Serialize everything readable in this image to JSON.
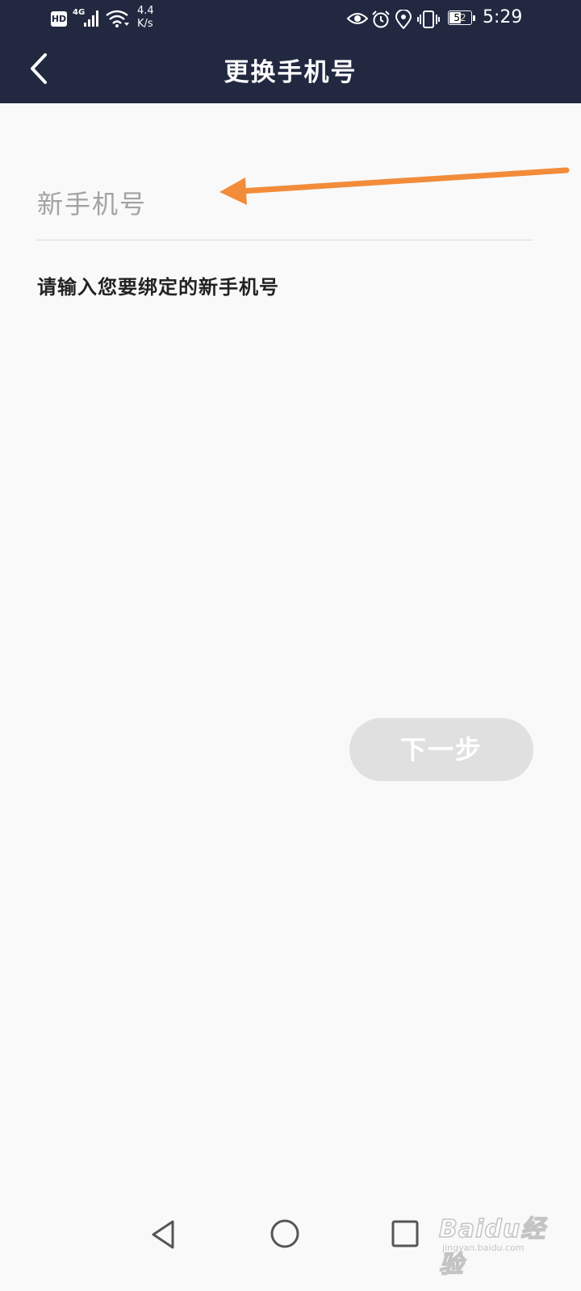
{
  "status_bar": {
    "hd_label": "HD",
    "network_label": "4G",
    "speed_value": "4.4",
    "speed_unit": "K/s",
    "battery_level": "52",
    "time": "5:29",
    "icons": [
      "hd-icon",
      "signal-icon",
      "wifi-icon",
      "eye-icon",
      "alarm-icon",
      "location-icon",
      "vibrate-icon",
      "battery-icon"
    ]
  },
  "header": {
    "title": "更换手机号",
    "back_icon": "chevron-left-icon"
  },
  "form": {
    "phone_placeholder": "新手机号",
    "phone_value": "",
    "hint": "请输入您要绑定的新手机号"
  },
  "annotation": {
    "arrow_color": "#f28c3a"
  },
  "next_button": {
    "label": "下一步",
    "enabled": false
  },
  "nav_bar": {
    "icons": [
      "back-triangle-icon",
      "home-circle-icon",
      "recents-square-icon"
    ]
  },
  "watermark": {
    "brand": "Baidu经验",
    "url": "jingyan.baidu.com"
  },
  "colors": {
    "header_bg": "#212840",
    "page_bg": "#f9f9f9",
    "button_disabled_bg": "#e0e0e0",
    "placeholder": "#a3a3a3"
  }
}
